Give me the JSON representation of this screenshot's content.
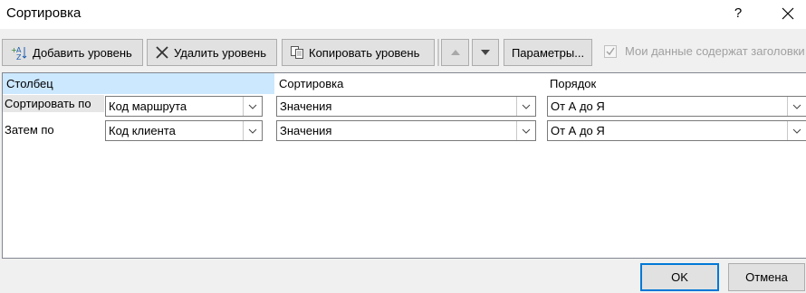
{
  "window": {
    "title": "Сортировка",
    "help": "?"
  },
  "toolbar": {
    "add_level": "Добавить уровень",
    "delete_level": "Удалить уровень",
    "copy_level": "Копировать уровень",
    "options": "Параметры...",
    "headers_checkbox": "Мои данные содержат заголовки",
    "headers_checked": true
  },
  "grid": {
    "headers": {
      "column": "Столбец",
      "sort_on": "Сортировка",
      "order": "Порядок"
    },
    "rows": [
      {
        "label": "Сортировать по",
        "column": "Код маршрута",
        "sort_on": "Значения",
        "order": "От А до Я"
      },
      {
        "label": "Затем по",
        "column": "Код клиента",
        "sort_on": "Значения",
        "order": "От А до Я"
      }
    ]
  },
  "buttons": {
    "ok": "OK",
    "cancel": "Отмена"
  }
}
